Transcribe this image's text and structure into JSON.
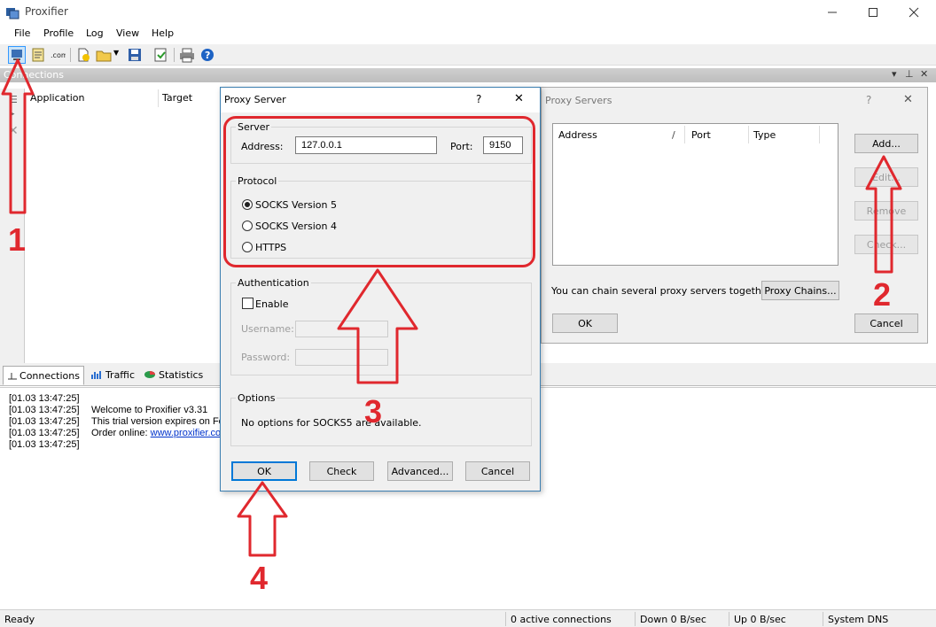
{
  "window": {
    "title": "Proxifier"
  },
  "menu": [
    "File",
    "Profile",
    "Log",
    "View",
    "Help"
  ],
  "toolbar_icons": [
    "proxy-servers-icon",
    "proxification-rules-icon",
    "name-resolution-icon",
    "new-profile-icon",
    "open-profile-icon",
    "save-profile-icon",
    "export-icon",
    "print-icon",
    "help-icon"
  ],
  "connections": {
    "pane_title": "Connections",
    "columns": [
      "Application",
      "Target"
    ]
  },
  "bottom_tabs": [
    "Connections",
    "Traffic",
    "Statistics"
  ],
  "log": [
    {
      "time": "[01.03 13:47:25]",
      "msg": ""
    },
    {
      "time": "[01.03 13:47:25]",
      "msg": "Welcome to Proxifier v3.31"
    },
    {
      "time": "[01.03 13:47:25]",
      "msg": "This trial version expires on Feb"
    },
    {
      "time": "[01.03 13:47:25]",
      "msg": "Order online: ",
      "link": "www.proxifier.com"
    },
    {
      "time": "[01.03 13:47:25]",
      "msg": ""
    }
  ],
  "status": {
    "ready": "Ready",
    "active": "0 active connections",
    "down": "Down 0 B/sec",
    "up": "Up 0 B/sec",
    "dns": "System DNS"
  },
  "proxy_servers_dialog": {
    "title": "Proxy Servers",
    "help": "?",
    "close": "✕",
    "columns": [
      "Address",
      "/",
      "Port",
      "Type"
    ],
    "buttons": {
      "add": "Add...",
      "edit": "Edit...",
      "remove": "Remove",
      "check": "Check..."
    },
    "chain_text": "You can chain several proxy servers together:",
    "chain_button": "Proxy Chains...",
    "ok": "OK",
    "cancel": "Cancel"
  },
  "proxy_server_dialog": {
    "title": "Proxy Server",
    "help": "?",
    "close": "✕",
    "server_group": "Server",
    "address_label": "Address:",
    "address_value": "127.0.0.1",
    "port_label": "Port:",
    "port_value": "9150",
    "protocol_group": "Protocol",
    "protocols": [
      "SOCKS Version 5",
      "SOCKS Version 4",
      "HTTPS"
    ],
    "selected_protocol": "SOCKS Version 5",
    "auth_group": "Authentication",
    "enable_label": "Enable",
    "username_label": "Username:",
    "password_label": "Password:",
    "options_group": "Options",
    "options_text": "No options for SOCKS5 are available.",
    "buttons": {
      "ok": "OK",
      "check": "Check",
      "advanced": "Advanced...",
      "cancel": "Cancel"
    }
  },
  "annotations": [
    "1",
    "2",
    "3",
    "4"
  ],
  "colors": {
    "annotation": "#e0282e",
    "focus": "#0078d7"
  }
}
